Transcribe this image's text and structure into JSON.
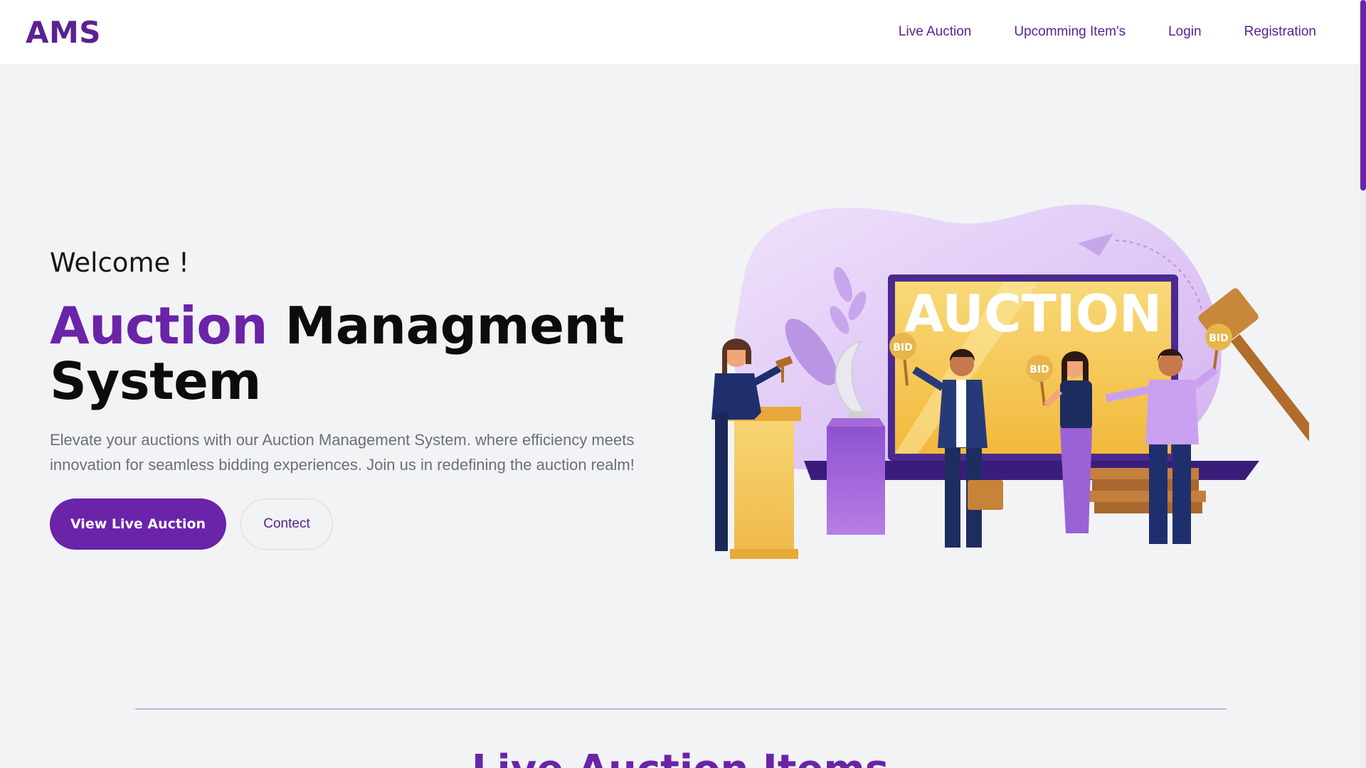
{
  "brand": "AMS",
  "nav": {
    "items": [
      "Live Auction",
      "Upcomming Item's",
      "Login",
      "Registration"
    ]
  },
  "hero": {
    "welcome": "Welcome !",
    "title_accent": "Auction",
    "title_rest": " Managment System",
    "description": "Elevate your auctions with our Auction Management System. where efficiency meets innovation for seamless bidding experiences. Join us in redefining the auction realm!",
    "primary_button": "View Live Auction",
    "secondary_button": "Contect"
  },
  "illustration": {
    "screen_text": "AUCTION",
    "bid_label": "BID"
  },
  "section": {
    "title": "Live Auction Items"
  },
  "colors": {
    "accent": "#6a23a9",
    "brand": "#5b2191",
    "background": "#f2f3f5"
  }
}
